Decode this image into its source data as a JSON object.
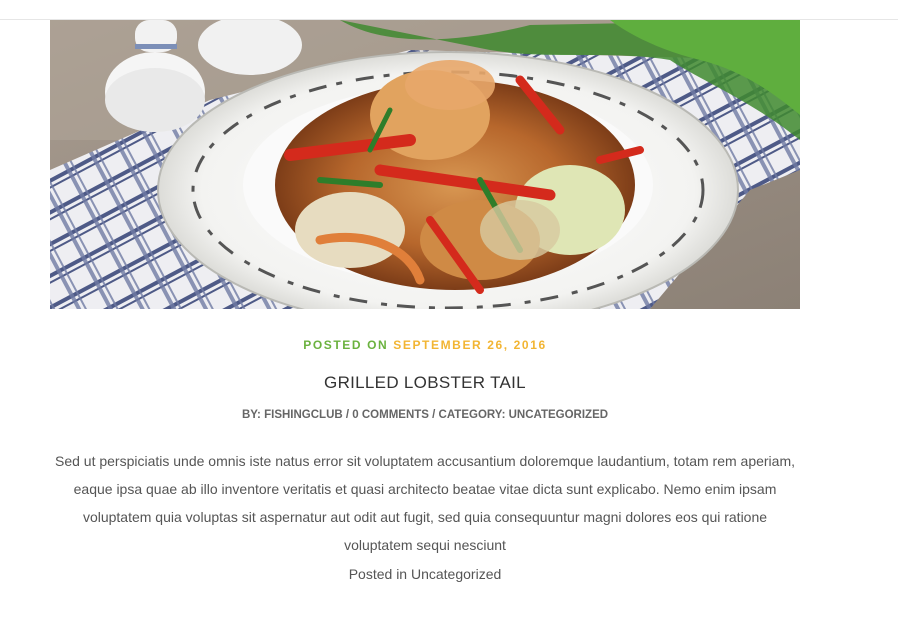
{
  "post": {
    "posted_on_label": "POSTED ON",
    "date": "SEPTEMBER 26, 2016",
    "title": "GRILLED LOBSTER TAIL",
    "byline": {
      "by_prefix": "BY: ",
      "author": "FISHINGCLUB",
      "sep1": " / ",
      "comments": "0 COMMENTS",
      "sep2": " / ",
      "category_prefix": "CATEGORY: ",
      "category": "UNCATEGORIZED"
    },
    "excerpt": "Sed ut perspiciatis unde omnis iste natus error sit voluptatem accusantium doloremque laudantium, totam rem aperiam, eaque ipsa quae ab illo inventore veritatis et quasi architecto beatae vitae dicta sunt explicabo. Nemo enim ipsam voluptatem quia voluptas sit aspernatur aut odit aut fugit, sed quia consequuntur magni dolores eos qui ratione voluptatem sequi nesciunt",
    "footer": {
      "posted_in_label": "Posted in ",
      "category_link": "Uncategorized"
    }
  },
  "colors": {
    "posted_on": "#6bb23f",
    "date_accent": "#f2b533",
    "title": "#333333",
    "byline": "#666666",
    "body_text": "#555555"
  }
}
